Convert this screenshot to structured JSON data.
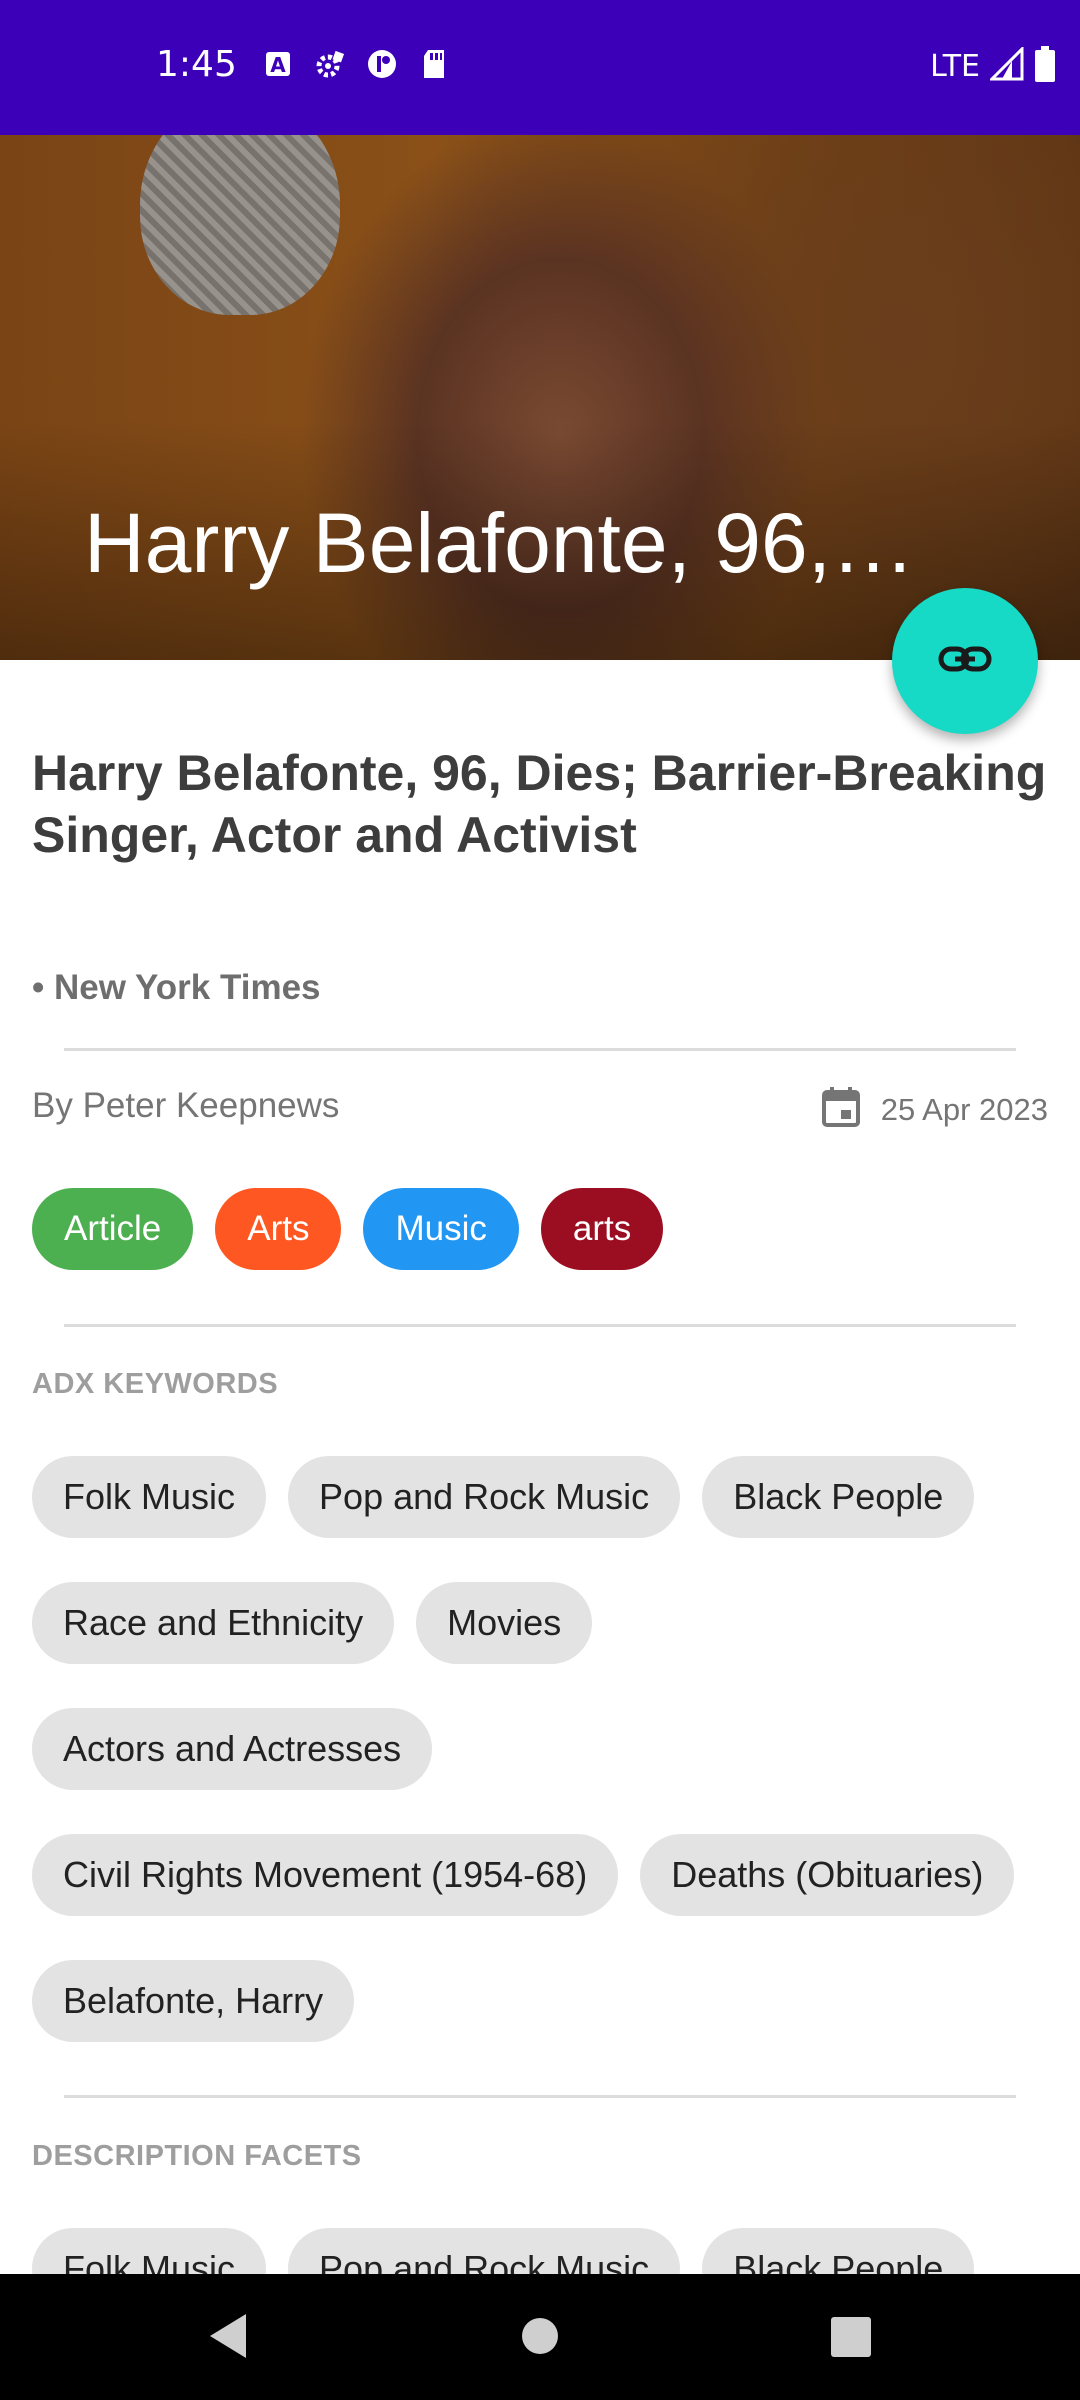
{
  "status": {
    "time": "1:45",
    "network": "LTE",
    "icons": [
      "a-notification-icon",
      "gear-notification-icon",
      "circle-notification-icon",
      "sd-card-icon",
      "signal-icon",
      "battery-icon"
    ]
  },
  "hero": {
    "title": "Harry Belafonte, 96,…"
  },
  "fab": {
    "icon": "link-icon",
    "color": "#16D9C6"
  },
  "article": {
    "headline": "Harry Belafonte, 96, Dies; Barrier-Breaking Singer, Actor and Activist",
    "source": "• New York Times",
    "byline": "By Peter Keepnews",
    "date": "25 Apr 2023"
  },
  "tags": [
    {
      "label": "Article",
      "color": "#4CAF50"
    },
    {
      "label": "Arts",
      "color": "#FF5722"
    },
    {
      "label": "Music",
      "color": "#2196F3"
    },
    {
      "label": "arts",
      "color": "#9B0D20"
    }
  ],
  "adx": {
    "label": "ADX KEYWORDS",
    "keywords": [
      "Folk Music",
      "Pop and Rock Music",
      "Black People",
      "Race and Ethnicity",
      "Movies",
      "Actors and Actresses",
      "Civil Rights Movement (1954-68)",
      "Deaths (Obituaries)",
      "Belafonte, Harry"
    ]
  },
  "facets": {
    "label": "DESCRIPTION FACETS",
    "keywords": [
      "Folk Music",
      "Pop and Rock Music",
      "Black People"
    ]
  },
  "colors": {
    "status_bar": "#3C00B8",
    "chip_bg": "#e3e3e3"
  }
}
